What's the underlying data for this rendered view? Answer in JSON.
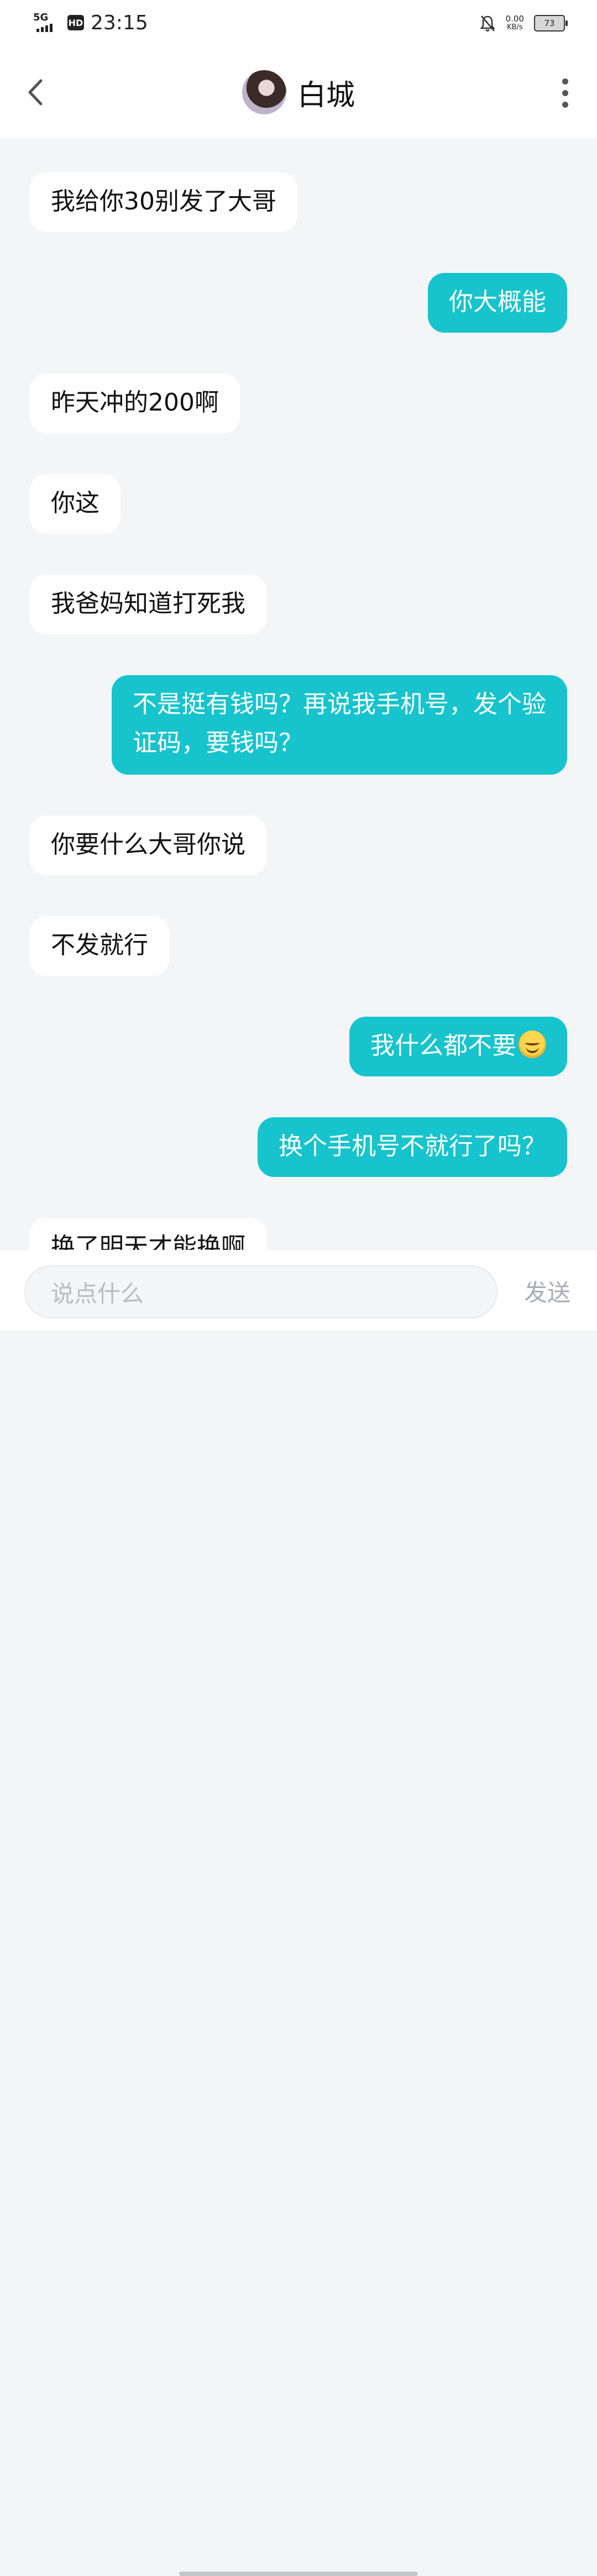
{
  "status_bar": {
    "network": "5G",
    "hd": "HD",
    "time": "23:15",
    "speed_value": "0.00",
    "speed_unit": "KB/s",
    "battery": "73"
  },
  "header": {
    "title": "白城",
    "back_icon": "chevron-left-icon",
    "more_icon": "more-vertical-icon"
  },
  "messages": [
    {
      "side": "left",
      "text": "我给你30别发了大哥"
    },
    {
      "side": "right",
      "text": "你大概能"
    },
    {
      "side": "left",
      "text": "昨天冲的200啊"
    },
    {
      "side": "left",
      "text": "你这"
    },
    {
      "side": "left",
      "text": "我爸妈知道打死我"
    },
    {
      "side": "right",
      "line1": "不是挺有钱吗？再说我手机号，发个验",
      "line2": "证码，要钱吗？"
    },
    {
      "side": "left",
      "text": "你要什么大哥你说"
    },
    {
      "side": "left",
      "text": "不发就行"
    },
    {
      "side": "right",
      "text": "我什么都不要",
      "emoji": "smiling-face-icon"
    },
    {
      "side": "right",
      "text": "换个手机号不就行了吗？"
    },
    {
      "side": "left",
      "text": "换了明天才能换啊"
    }
  ],
  "composer": {
    "placeholder": "说点什么",
    "send_label": "发送"
  },
  "colors": {
    "accent": "#17c3cc",
    "background": "#f4f5f7"
  }
}
